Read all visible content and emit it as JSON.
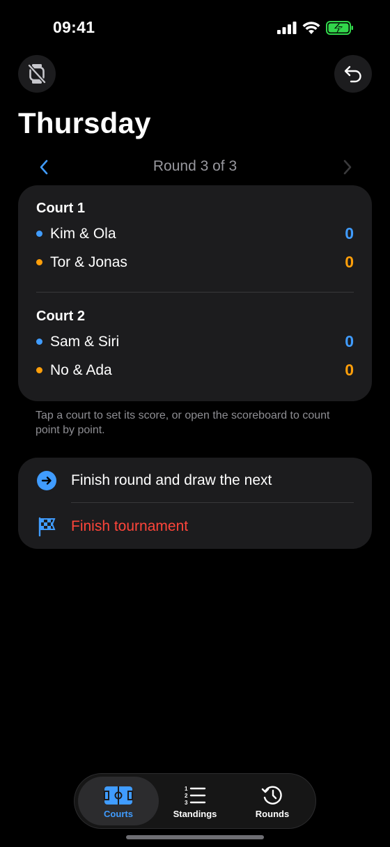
{
  "status_bar": {
    "time": "09:41"
  },
  "header": {
    "title": "Thursday"
  },
  "round_nav": {
    "label": "Round 3 of 3"
  },
  "courts": [
    {
      "title": "Court 1",
      "teams": [
        {
          "name": "Kim & Ola",
          "score": "0",
          "color": "#409cff"
        },
        {
          "name": "Tor & Jonas",
          "score": "0",
          "color": "#ff9f0a"
        }
      ]
    },
    {
      "title": "Court 2",
      "teams": [
        {
          "name": "Sam & Siri",
          "score": "0",
          "color": "#409cff"
        },
        {
          "name": "No & Ada",
          "score": "0",
          "color": "#ff9f0a"
        }
      ]
    }
  ],
  "hint": "Tap a court to set its score, or open the scoreboard to count point by point.",
  "actions": {
    "next_round": {
      "label": "Finish round and draw the next",
      "icon": "arrow-right-circle-icon"
    },
    "finish_tournament": {
      "label": "Finish tournament",
      "icon": "checkered-flag-icon",
      "color": "#ff453a"
    }
  },
  "tabbar": {
    "tabs": [
      {
        "label": "Courts",
        "icon": "court-icon",
        "active": true
      },
      {
        "label": "Standings",
        "icon": "numbered-list-icon",
        "active": false
      },
      {
        "label": "Rounds",
        "icon": "history-clock-icon",
        "active": false
      }
    ]
  },
  "colors": {
    "accent": "#409cff",
    "team_a": "#409cff",
    "team_b": "#ff9f0a",
    "danger": "#ff453a"
  }
}
